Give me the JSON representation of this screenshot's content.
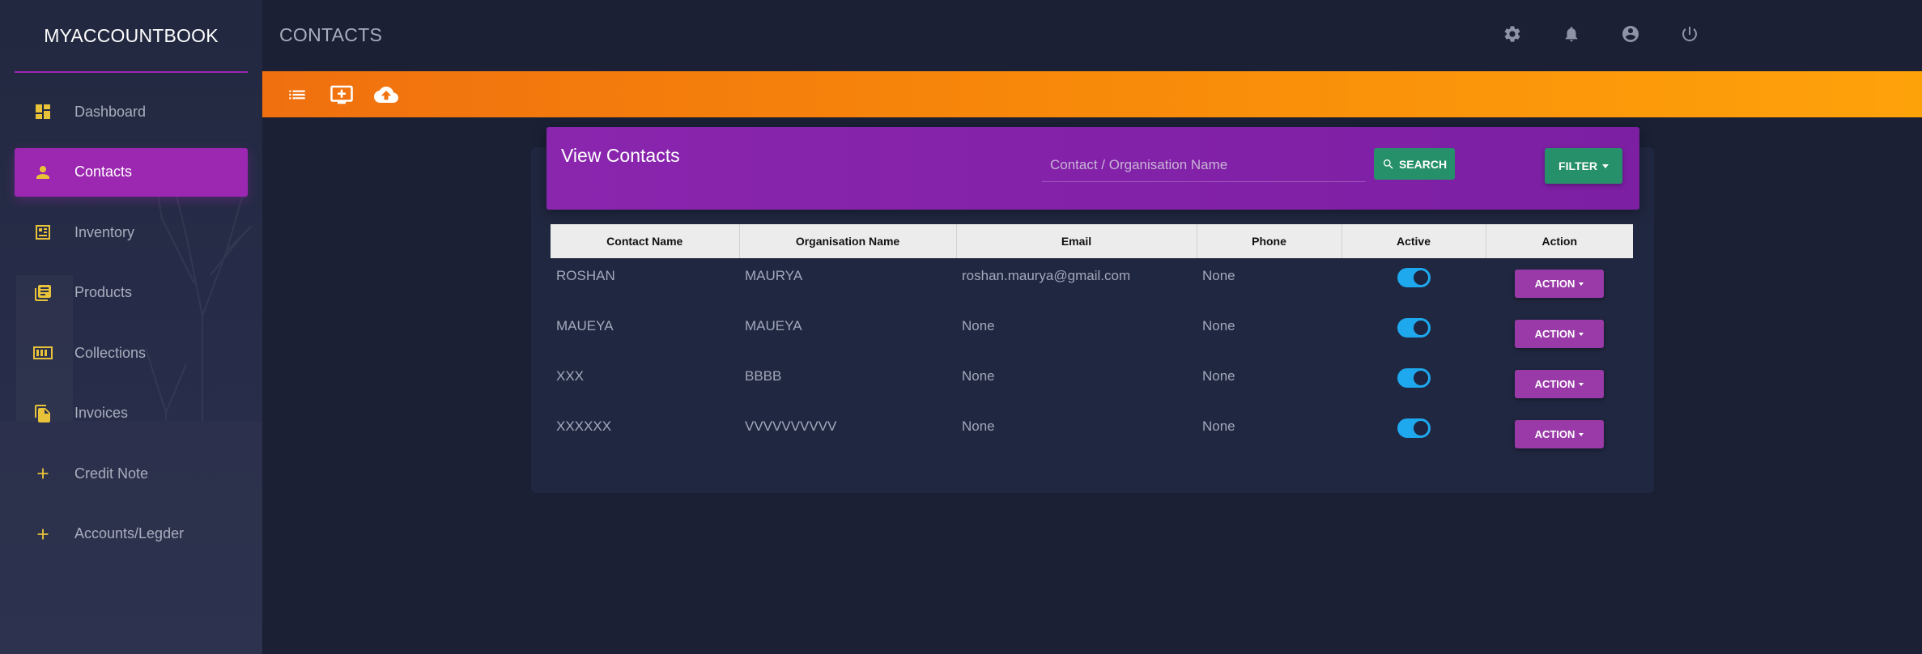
{
  "app": {
    "brand": "MYACCOUNTBOOK",
    "page_title": "CONTACTS"
  },
  "colors": {
    "accent_purple": "#9c27b0",
    "orange_start": "#f0700f",
    "orange_end": "#fea20a",
    "green_button": "#26906a",
    "toggle_on": "#1ea8ee",
    "nav_icon": "#e8c33a"
  },
  "sidebar": {
    "items": [
      {
        "label": "Dashboard",
        "icon": "dashboard-icon",
        "active": false
      },
      {
        "label": "Contacts",
        "icon": "person-icon",
        "active": true
      },
      {
        "label": "Inventory",
        "icon": "inventory-icon",
        "active": false
      },
      {
        "label": "Products",
        "icon": "products-icon",
        "active": false
      },
      {
        "label": "Collections",
        "icon": "collections-icon",
        "active": false
      },
      {
        "label": "Invoices",
        "icon": "invoices-icon",
        "active": false
      },
      {
        "label": "Credit Note",
        "icon": "plus-icon",
        "active": false
      },
      {
        "label": "Accounts/Legder",
        "icon": "plus-icon",
        "active": false
      }
    ]
  },
  "topbar": {
    "icons": [
      "settings-icon",
      "notifications-icon",
      "account-icon",
      "power-icon"
    ]
  },
  "toolbar": {
    "icons": [
      "list-icon",
      "add-screen-icon",
      "cloud-upload-icon"
    ]
  },
  "contacts": {
    "title": "View Contacts",
    "search_placeholder": "Contact / Organisation Name",
    "search_label": "SEARCH",
    "filter_label": "FILTER",
    "columns": [
      "Contact Name",
      "Organisation Name",
      "Email",
      "Phone",
      "Active",
      "Action"
    ],
    "rows": [
      {
        "name": "ROSHAN",
        "org": "MAURYA",
        "email": "roshan.maurya@gmail.com",
        "phone": "None",
        "active": true,
        "action": "ACTION"
      },
      {
        "name": "MAUEYA",
        "org": "MAUEYA",
        "email": "None",
        "phone": "None",
        "active": true,
        "action": "ACTION"
      },
      {
        "name": "XXX",
        "org": "BBBB",
        "email": "None",
        "phone": "None",
        "active": true,
        "action": "ACTION"
      },
      {
        "name": "XXXXXX",
        "org": "VVVVVVVVVV",
        "email": "None",
        "phone": "None",
        "active": true,
        "action": "ACTION"
      }
    ]
  }
}
